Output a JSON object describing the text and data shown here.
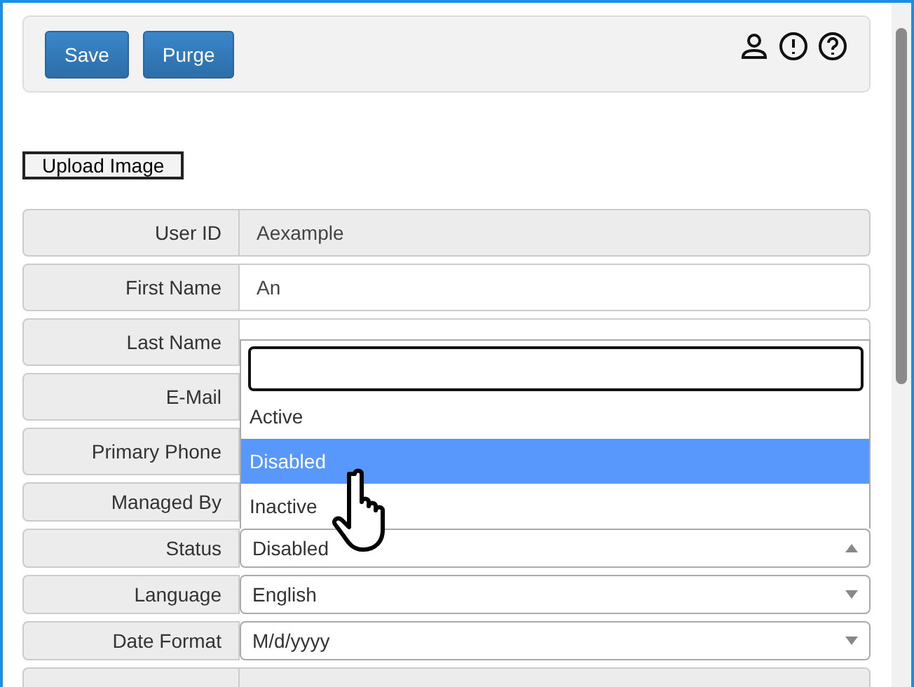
{
  "toolbar": {
    "buttons": [
      "Save",
      "Purge"
    ]
  },
  "upload_button": "Upload Image",
  "fields": [
    {
      "label": "User ID",
      "kind": "readonly",
      "value": "Aexample"
    },
    {
      "label": "First Name",
      "kind": "text",
      "value": "An"
    },
    {
      "label": "Last Name",
      "kind": "text"
    },
    {
      "label": "E-Mail",
      "kind": "covered"
    },
    {
      "label": "Primary Phone",
      "kind": "covered"
    },
    {
      "label": "Managed By",
      "kind": "covered"
    },
    {
      "label": "Status",
      "kind": "select",
      "value": "Disabled",
      "open": true
    },
    {
      "label": "Language",
      "kind": "select",
      "value": "English",
      "open": false
    },
    {
      "label": "Date Format",
      "kind": "select",
      "value": "M/d/yyyy",
      "open": false
    },
    {
      "kind": "readonly"
    }
  ],
  "status_dropdown": {
    "options": [
      {
        "label": "Active",
        "selected": false
      },
      {
        "label": "Disabled",
        "selected": true
      },
      {
        "label": "Inactive",
        "selected": false
      }
    ]
  }
}
